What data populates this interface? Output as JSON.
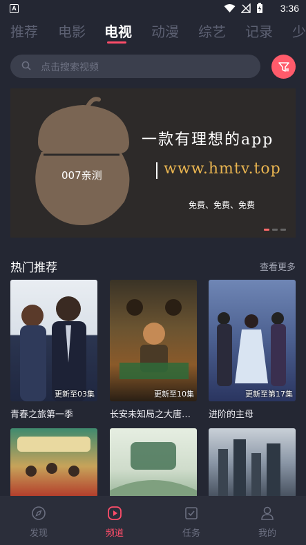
{
  "statusbar": {
    "time": "3:36",
    "app_badge": "A"
  },
  "tabs": [
    "推荐",
    "电影",
    "电视",
    "动漫",
    "综艺",
    "记录",
    "少"
  ],
  "active_tab_index": 2,
  "search": {
    "placeholder": "点击搜索视频"
  },
  "banner": {
    "logo_label": "007亲测",
    "tagline": "一款有理想的app",
    "url": "www.hmtv.top",
    "free_text": "免费、免费、免费"
  },
  "section": {
    "title": "热门推荐",
    "more": "查看更多"
  },
  "cards": [
    {
      "title": "青春之旅第一季",
      "badge": "更新至03集"
    },
    {
      "title": "长安未知局之大唐…",
      "badge": "更新至10集"
    },
    {
      "title": "进阶的主母",
      "badge": "更新至第17集"
    }
  ],
  "bottom_nav": [
    {
      "label": "发现",
      "icon": "compass-icon"
    },
    {
      "label": "频道",
      "icon": "play-icon"
    },
    {
      "label": "任务",
      "icon": "task-icon"
    },
    {
      "label": "我的",
      "icon": "user-icon"
    }
  ],
  "colors": {
    "accent": "#ff4d6a",
    "background": "#242733"
  }
}
